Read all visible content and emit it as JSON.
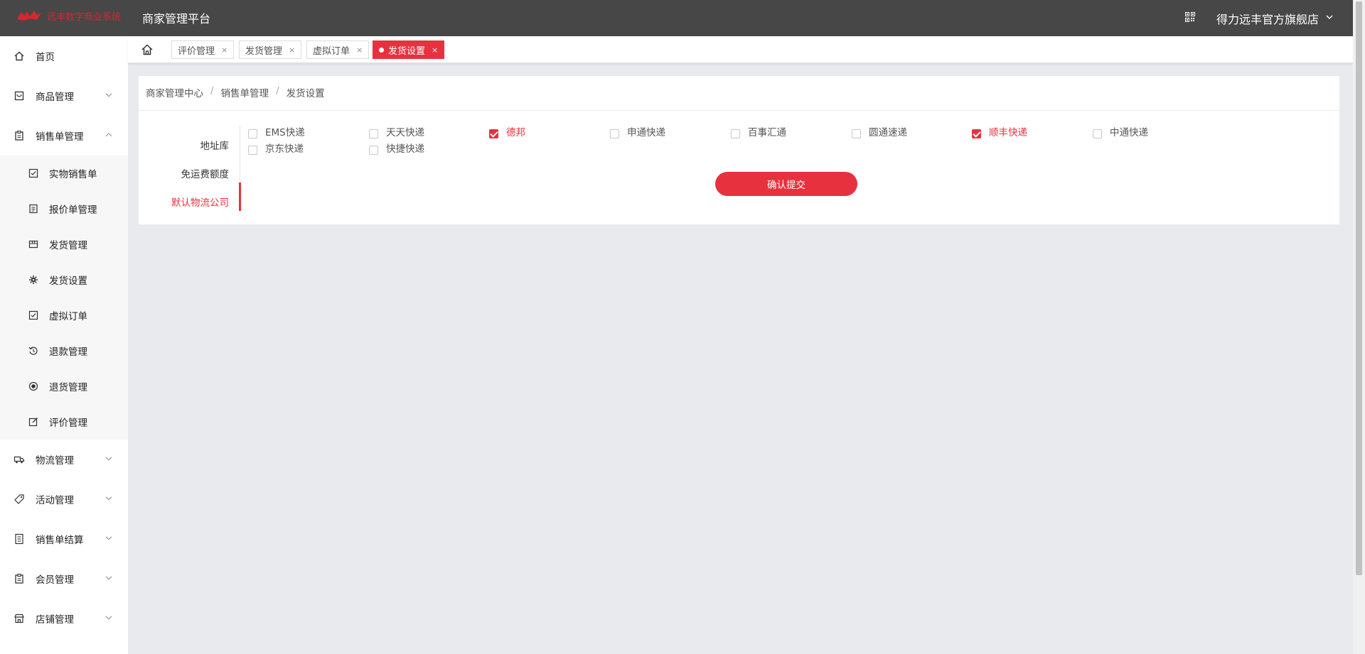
{
  "header": {
    "logo_text": "远丰数字商业系统",
    "app_title": "商家管理平台",
    "store_name": "得力远丰官方旗舰店",
    "brand_color": "#d8262f",
    "bar_color": "#474747"
  },
  "sidebar": {
    "items": [
      {
        "label": "首页",
        "icon": "home-icon",
        "expandable": false
      },
      {
        "label": "商品管理",
        "icon": "goods-icon",
        "expandable": true,
        "expanded": false
      },
      {
        "label": "销售单管理",
        "icon": "order-icon",
        "expandable": true,
        "expanded": true
      },
      {
        "label": "物流管理",
        "icon": "truck-icon",
        "expandable": true,
        "expanded": false
      },
      {
        "label": "活动管理",
        "icon": "tag-icon",
        "expandable": true,
        "expanded": false
      },
      {
        "label": "销售单结算",
        "icon": "settlement-icon",
        "expandable": true,
        "expanded": false
      },
      {
        "label": "会员管理",
        "icon": "member-icon",
        "expandable": true,
        "expanded": false
      },
      {
        "label": "店铺管理",
        "icon": "shop-icon",
        "expandable": true,
        "expanded": false
      }
    ],
    "sub_items": [
      {
        "label": "实物销售单",
        "icon": "checklist-icon"
      },
      {
        "label": "报价单管理",
        "icon": "document-icon"
      },
      {
        "label": "发货管理",
        "icon": "box-icon"
      },
      {
        "label": "发货设置",
        "icon": "gear-icon"
      },
      {
        "label": "虚拟订单",
        "icon": "checklist-icon"
      },
      {
        "label": "退款管理",
        "icon": "refund-icon"
      },
      {
        "label": "退货管理",
        "icon": "return-icon"
      },
      {
        "label": "评价管理",
        "icon": "edit-icon"
      }
    ]
  },
  "tabs": [
    {
      "label": "评价管理",
      "active": false
    },
    {
      "label": "发货管理",
      "active": false
    },
    {
      "label": "虚拟订单",
      "active": false
    },
    {
      "label": "发货设置",
      "active": true
    }
  ],
  "tab_close_glyph": "×",
  "breadcrumb": [
    "商家管理中心",
    "销售单管理",
    "发货设置"
  ],
  "breadcrumb_sep": "/",
  "settings_tabs": [
    {
      "label": "地址库",
      "active": false
    },
    {
      "label": "免运费额度",
      "active": false
    },
    {
      "label": "默认物流公司",
      "active": true
    }
  ],
  "couriers": [
    {
      "label": "EMS快递",
      "checked": false
    },
    {
      "label": "天天快递",
      "checked": false
    },
    {
      "label": "德邦",
      "checked": true
    },
    {
      "label": "申通快递",
      "checked": false
    },
    {
      "label": "百事汇通",
      "checked": false
    },
    {
      "label": "圆通速递",
      "checked": false
    },
    {
      "label": "顺丰快递",
      "checked": true
    },
    {
      "label": "中通快递",
      "checked": false
    },
    {
      "label": "京东快递",
      "checked": false
    },
    {
      "label": "快捷快递",
      "checked": false
    }
  ],
  "submit_label": "确认提交",
  "accent_color": "#e8313e"
}
